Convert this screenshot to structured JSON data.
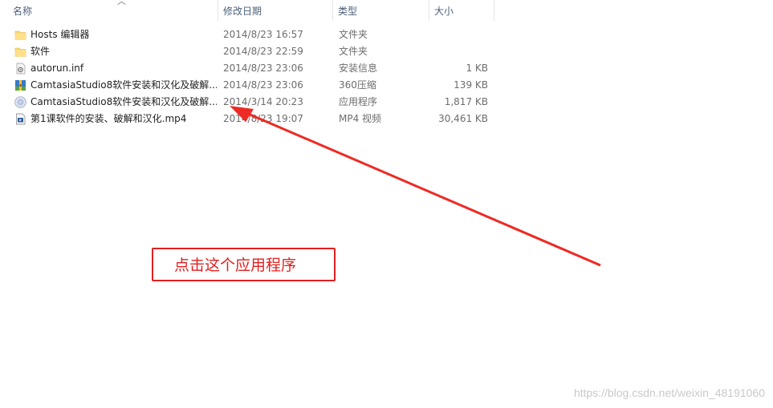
{
  "columns": {
    "name": "名称",
    "date": "修改日期",
    "type": "类型",
    "size": "大小"
  },
  "files": [
    {
      "name": "Hosts 编辑器",
      "date": "2014/8/23 16:57",
      "type": "文件夹",
      "size": "",
      "icon": "folder-icon"
    },
    {
      "name": "软件",
      "date": "2014/8/23 22:59",
      "type": "文件夹",
      "size": "",
      "icon": "folder-icon"
    },
    {
      "name": "autorun.inf",
      "date": "2014/8/23 23:06",
      "type": "安装信息",
      "size": "1 KB",
      "icon": "settings-file-icon"
    },
    {
      "name": "CamtasiaStudio8软件安装和汉化及破解...",
      "date": "2014/8/23 23:06",
      "type": "360压缩",
      "size": "139 KB",
      "icon": "archive-icon"
    },
    {
      "name": "CamtasiaStudio8软件安装和汉化及破解...",
      "date": "2014/3/14 20:23",
      "type": "应用程序",
      "size": "1,817 KB",
      "icon": "disc-app-icon"
    },
    {
      "name": "第1课软件的安装、破解和汉化.mp4",
      "date": "2014/8/23 19:07",
      "type": "MP4 视频",
      "size": "30,461 KB",
      "icon": "video-file-icon"
    }
  ],
  "annotation": {
    "callout_text": "点击这个应用程序",
    "color": "#e02020"
  },
  "watermark": "https://blog.csdn.net/weixin_48191060"
}
